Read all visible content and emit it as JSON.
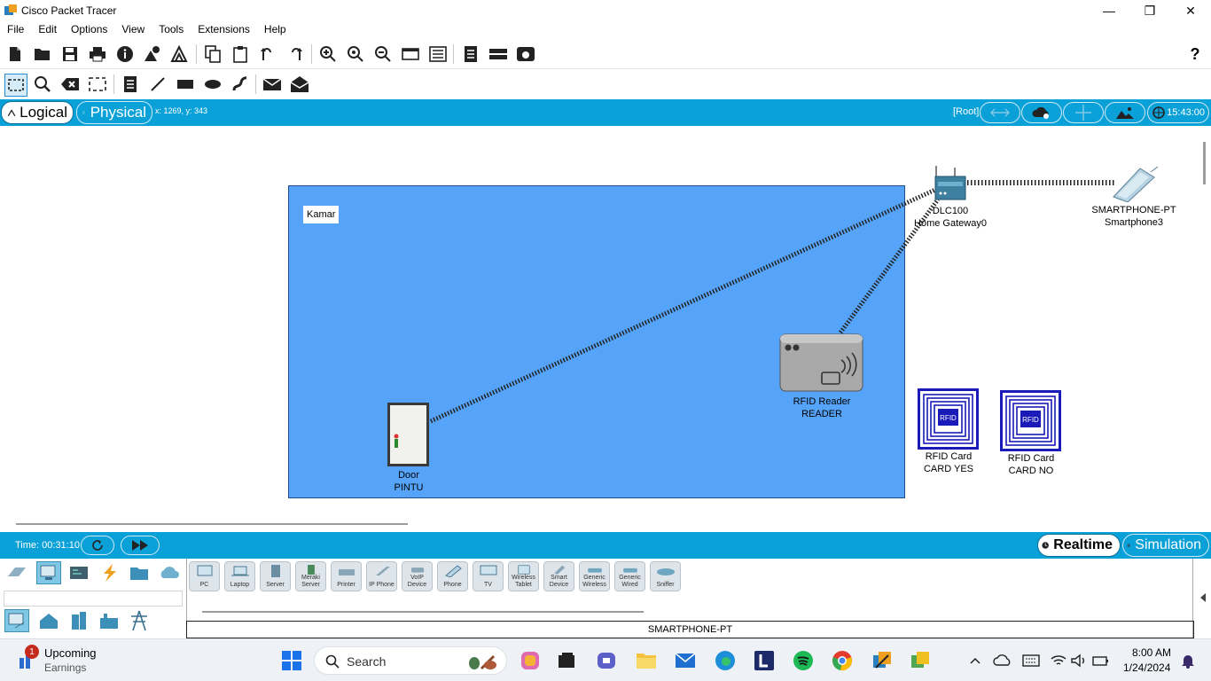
{
  "window": {
    "title": "Cisco Packet Tracer"
  },
  "menu": [
    "File",
    "Edit",
    "Options",
    "View",
    "Tools",
    "Extensions",
    "Help"
  ],
  "modebar": {
    "logical_label": "Logical",
    "physical_label": "Physical",
    "coords": "x: 1269, y: 343",
    "root_label": "[Root]",
    "clock": "15:43:00"
  },
  "workspace": {
    "cluster_label": "Kamar",
    "devices": {
      "gateway": {
        "model": "DLC100",
        "name": "Home Gateway0"
      },
      "smartphone": {
        "model": "SMARTPHONE-PT",
        "name": "Smartphone3"
      },
      "rfid_reader": {
        "model": "RFID Reader",
        "name": "READER"
      },
      "door": {
        "model": "Door",
        "name": "PINTU"
      },
      "card_yes": {
        "model": "RFID Card",
        "name": "CARD YES",
        "tag": "RFID"
      },
      "card_no": {
        "model": "RFID Card",
        "name": "CARD NO",
        "tag": "RFID"
      }
    }
  },
  "bottombar": {
    "time": "Time: 00:31:10",
    "realtime_label": "Realtime",
    "simulation_label": "Simulation"
  },
  "device_panel": {
    "items": [
      "PC",
      "Laptop",
      "Server",
      "Meraki Server",
      "Printer",
      "IP Phone",
      "VoIP Device",
      "Phone",
      "TV",
      "Wireless Tablet",
      "Smart Device",
      "Generic Wireless",
      "Generic Wired",
      "Sniffer"
    ],
    "selected_device": "SMARTPHONE-PT"
  },
  "taskbar": {
    "widget_badge": "1",
    "widget_title": "Upcoming",
    "widget_subtitle": "Earnings",
    "search_label": "Search",
    "time": "8:00 AM",
    "date": "1/24/2024"
  },
  "colors": {
    "accent_bar": "#0aa1d9",
    "cluster_fill": "#56a4f9",
    "rfid_blue": "#1a1ab8"
  }
}
